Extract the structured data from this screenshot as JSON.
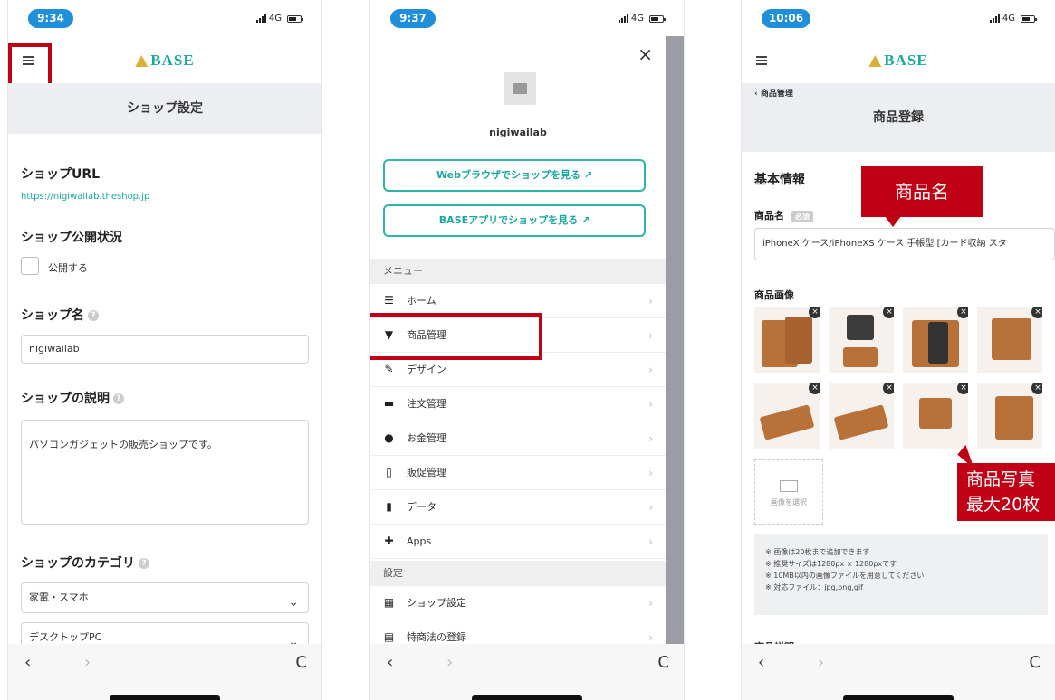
{
  "brand": {
    "logo": "BASE",
    "accent": "#1aa89c",
    "highlight": "#c00014"
  },
  "screen1": {
    "time": "9:34",
    "network": "4G",
    "title": "ショップ設定",
    "shop_url_label": "ショップURL",
    "shop_url": "https://nigiwailab.theshop.jp",
    "publish_label": "ショップ公開状況",
    "publish_checkbox": "公開する",
    "shop_name_label": "ショップ名",
    "shop_name_value": "nigiwailab",
    "desc_label": "ショップの説明",
    "desc_value": "パソコンガジェットの販売ショップです。",
    "category_label": "ショップのカテゴリ",
    "category_1": "家電・スマホ",
    "category_2": "デスクトップPC"
  },
  "screen2": {
    "time": "9:37",
    "network": "4G",
    "close": "×",
    "shop_name": "nigiwailab",
    "btn_web": "Webブラウザでショップを見る ↗",
    "btn_app": "BASEアプリでショップを見る ↗",
    "section_menu": "メニュー",
    "menu": [
      "ホーム",
      "商品管理",
      "デザイン",
      "注文管理",
      "お金管理",
      "販促管理",
      "データ",
      "Apps"
    ],
    "section_settings": "設定",
    "settings": [
      "ショップ設定",
      "特商法の登録"
    ]
  },
  "screen3": {
    "time": "10:06",
    "network": "4G",
    "back": "商品管理",
    "title": "商品登録",
    "basic_info": "基本情報",
    "product_name_label": "商品名",
    "required_badge": "必須",
    "product_name_value": "iPhoneX ケース/iPhoneXS ケース 手帳型 [カード収納 スタ",
    "images_label": "商品画像",
    "select_image": "画像を選択",
    "notes": [
      "※ 画像は20枚まで追加できます",
      "※ 推奨サイズは1280px × 1280pxです",
      "※ 10MB以内の画像ファイルを用意してください",
      "※ 対応ファイル：jpg,png,gif"
    ],
    "next_label": "商品説明",
    "callout_name": "商品名",
    "callout_photo_1": "商品写真",
    "callout_photo_2": "最大20枚"
  },
  "browser": {
    "back": "‹",
    "forward": "›",
    "reload": "C"
  }
}
